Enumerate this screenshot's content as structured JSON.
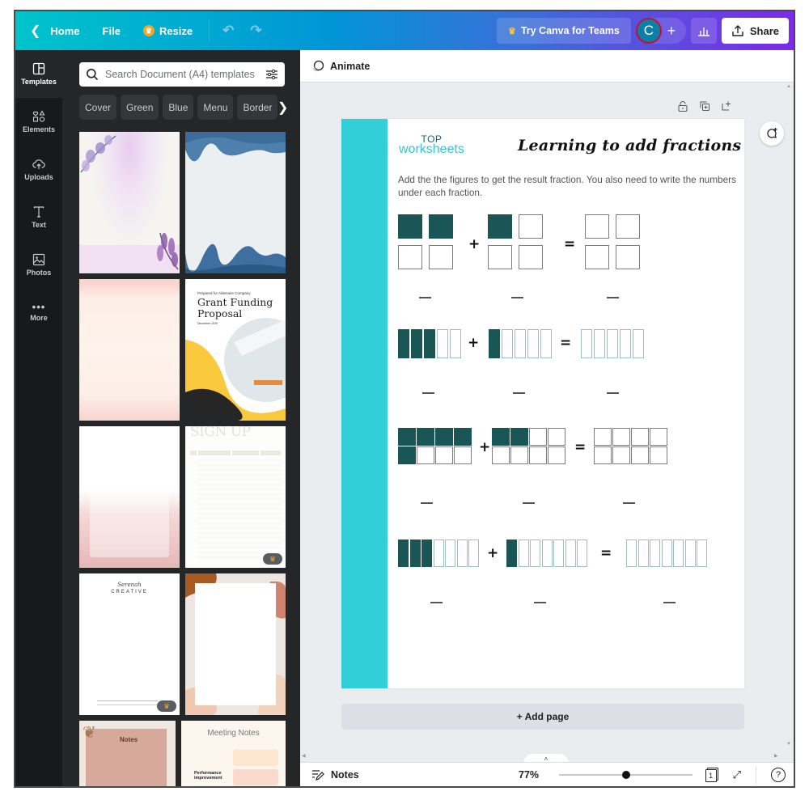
{
  "topbar": {
    "home_label": "Home",
    "file_label": "File",
    "resize_label": "Resize",
    "try_teams_label": "Try Canva for Teams",
    "avatar_initial": "C",
    "share_label": "Share",
    "gradient_start": "#00c4cc",
    "gradient_end": "#7d2ae8"
  },
  "rail": {
    "items": [
      {
        "label": "Templates",
        "icon": "templates-icon",
        "active": true
      },
      {
        "label": "Elements",
        "icon": "elements-icon"
      },
      {
        "label": "Uploads",
        "icon": "upload-cloud-icon"
      },
      {
        "label": "Text",
        "icon": "text-icon"
      },
      {
        "label": "Photos",
        "icon": "photos-icon"
      },
      {
        "label": "More",
        "icon": "more-icon"
      }
    ]
  },
  "panel": {
    "search_placeholder": "Search Document (A4) templates",
    "chips": [
      "Cover",
      "Green",
      "Blue",
      "Menu",
      "Border"
    ],
    "templates": [
      {
        "name": "Purple floral watercolor"
      },
      {
        "name": "Blue watercolor border"
      },
      {
        "name": "Pink watercolor"
      },
      {
        "name": "Grant Funding Proposal",
        "kicker": "Prepared for Aldenaire Company",
        "title": "Grant Funding Proposal",
        "date": "December 2025"
      },
      {
        "name": "Pink watercolor frame"
      },
      {
        "name": "Sign Up sheet",
        "title": "SIGN UP",
        "pro": true
      },
      {
        "name": "Serenah Creative letterhead",
        "script": "Serenah",
        "title": "CREATIVE",
        "pro": true
      },
      {
        "name": "Terracotta abstract frame"
      },
      {
        "name": "Butterfly notes",
        "title": "Notes"
      },
      {
        "name": "Meeting Notes",
        "title": "Meeting Notes",
        "sub": "Performance improvement"
      }
    ]
  },
  "context_bar": {
    "animate_label": "Animate"
  },
  "worksheet": {
    "brand_top": "TOP",
    "brand_bottom": "worksheets",
    "title": "Learning to add fractions",
    "instructions": "Add the the figures to get the result fraction. You also need to write the numbers under each fraction.",
    "plus": "+",
    "equals": "=",
    "accent_color": "#31d0d9",
    "fill_color": "#1b5657",
    "problems": [
      {
        "shape": "grid",
        "cols": 2,
        "rows": 2,
        "a_filled": 2,
        "b_filled": 1,
        "total": 4
      },
      {
        "shape": "bars",
        "count": 5,
        "a_filled": 3,
        "b_filled": 1,
        "total": 5
      },
      {
        "shape": "grid",
        "cols": 4,
        "rows": 2,
        "a_filled": 5,
        "b_filled": 2,
        "total": 8
      },
      {
        "shape": "bars",
        "count": 7,
        "a_filled": 3,
        "b_filled": 1,
        "total": 7
      }
    ]
  },
  "canvas": {
    "add_page_label": "+ Add page"
  },
  "footer": {
    "notes_label": "Notes",
    "zoom_value": "77%",
    "zoom_fraction": 0.5,
    "page_count": "1"
  }
}
